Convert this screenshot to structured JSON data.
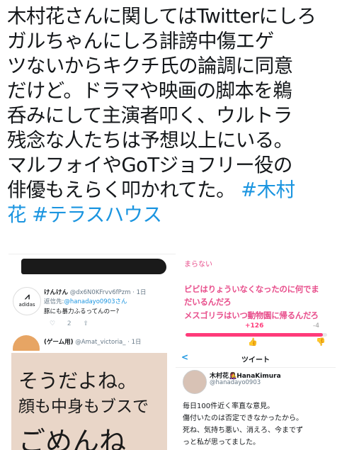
{
  "tweet": {
    "lines": [
      "木村花さんに関してはTwitterにしろ",
      "ガルちゃんにしろ誹謗中傷エゲ",
      "ツないからキクチ氏の論調に同意",
      "だけど。ドラマや映画の脚本を鵜",
      "呑みにして主演者叩く、ウルトラ",
      "残念な人たちは予想以上にいる。",
      "マルフォイやGoTジョフリー役の",
      "俳優もえらく叩かれてた。"
    ],
    "hashtag1": "#木村",
    "hashtag1_cont": "花",
    "hashtag2": "#テラスハウス"
  },
  "list_panel": {
    "user1_name": "けんけん",
    "user1_handle": "@dx6N0KFrvv6fPzm",
    "user1_time": "· 1日",
    "reply_prefix": "返信先:",
    "reply_handle": "@hanadayo0903さん",
    "user1_text": "豚にも暴力ふるってんのー?",
    "user1_actions": "♡ 2   ⇪",
    "avatar_text": "adidas",
    "user2_name": "(ゲーム用)",
    "user2_handle": "@Amat_victoria_",
    "user2_time": "· 1日"
  },
  "comments_panel": {
    "top": "まらない",
    "line1": "ビビはりょういなくなったのに何でま",
    "line2": "だいるんだろ",
    "line3": "メスゴリラはいつ動物園に帰るんだろ",
    "up_votes": "+126",
    "down_votes": "-4",
    "up_ratio": 0.97,
    "accent": "#e84f8c"
  },
  "message_panel": {
    "line1": "そうだよね。",
    "line2": "顔も中身もブスで",
    "line3": "ごめんね"
  },
  "tweet_panel": {
    "back": "<",
    "header": "ツイート",
    "name": "木村花👩‍🎤HanaKimura",
    "handle": "@hanadayo0903",
    "line1": "毎日100件近く率直な意見。",
    "line2": "傷付いたのは否定できなかったから。",
    "line3": "死ね、気持ち悪い、消えろ、今までず",
    "line4": "っと私が思ってました。"
  }
}
